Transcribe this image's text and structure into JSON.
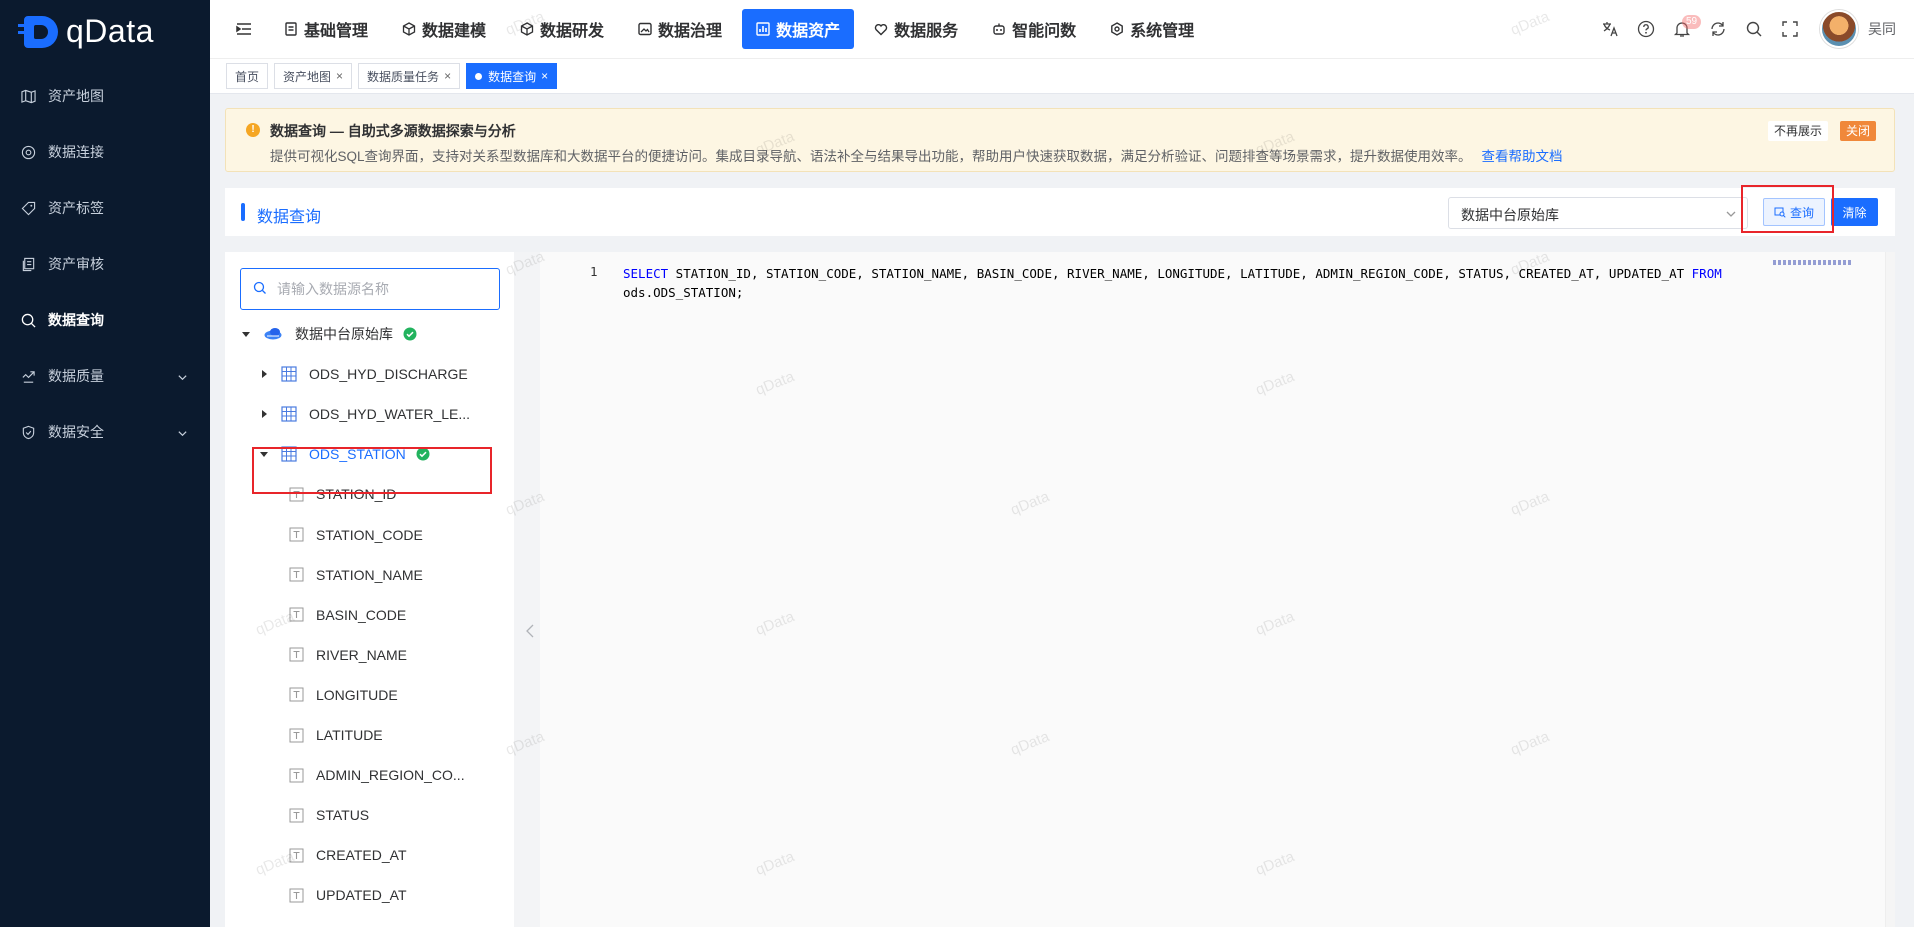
{
  "brand": {
    "name": "qData"
  },
  "sidebar": {
    "items": [
      {
        "label": "资产地图",
        "icon": "map-icon",
        "active": false,
        "expandable": false
      },
      {
        "label": "数据连接",
        "icon": "connection-icon",
        "active": false,
        "expandable": false
      },
      {
        "label": "资产标签",
        "icon": "tag-icon",
        "active": false,
        "expandable": false
      },
      {
        "label": "资产审核",
        "icon": "audit-icon",
        "active": false,
        "expandable": false
      },
      {
        "label": "数据查询",
        "icon": "query-icon",
        "active": true,
        "expandable": false
      },
      {
        "label": "数据质量",
        "icon": "quality-icon",
        "active": false,
        "expandable": true
      },
      {
        "label": "数据安全",
        "icon": "shield-icon",
        "active": false,
        "expandable": true
      }
    ]
  },
  "topnav": {
    "items": [
      {
        "label": "基础管理",
        "icon": "doc-icon",
        "active": false
      },
      {
        "label": "数据建模",
        "icon": "cube-icon",
        "active": false
      },
      {
        "label": "数据研发",
        "icon": "cube-icon",
        "active": false
      },
      {
        "label": "数据治理",
        "icon": "image-icon",
        "active": false
      },
      {
        "label": "数据资产",
        "icon": "chart-icon",
        "active": true
      },
      {
        "label": "数据服务",
        "icon": "heart-icon",
        "active": false
      },
      {
        "label": "智能问数",
        "icon": "robot-icon",
        "active": false
      },
      {
        "label": "系统管理",
        "icon": "gear-icon",
        "active": false
      }
    ],
    "notification_count": "59",
    "user_name": "吴同"
  },
  "tabs": [
    {
      "label": "首页",
      "closable": false,
      "active": false
    },
    {
      "label": "资产地图",
      "closable": true,
      "active": false
    },
    {
      "label": "数据质量任务",
      "closable": true,
      "active": false
    },
    {
      "label": "数据查询",
      "closable": true,
      "active": true
    }
  ],
  "notice": {
    "title": "数据查询 — 自助式多源数据探索与分析",
    "description": "提供可视化SQL查询界面，支持对关系型数据库和大数据平台的便捷访问。集成目录导航、语法补全与结果导出功能，帮助用户快速获取数据，满足分析验证、问题排查等场景需求，提升数据使用效率。",
    "link": "查看帮助文档",
    "hide_label": "不再展示",
    "close_label": "关闭"
  },
  "query_header": {
    "title": "数据查询",
    "datasource": "数据中台原始库",
    "query_button": "查询",
    "clear_button": "清除"
  },
  "tree": {
    "search_placeholder": "请输入数据源名称",
    "nodes": [
      {
        "label": "数据中台原始库",
        "level": 0,
        "type": "db",
        "expanded": true,
        "check": true
      },
      {
        "label": "ODS_HYD_DISCHARGE",
        "level": 1,
        "type": "table",
        "expanded": false,
        "check": false
      },
      {
        "label": "ODS_HYD_WATER_LE...",
        "level": 1,
        "type": "table",
        "expanded": false,
        "check": false
      },
      {
        "label": "ODS_STATION",
        "level": 1,
        "type": "table",
        "expanded": true,
        "check": true,
        "selected": true
      },
      {
        "label": "STATION_ID",
        "level": 2,
        "type": "column"
      },
      {
        "label": "STATION_CODE",
        "level": 2,
        "type": "column"
      },
      {
        "label": "STATION_NAME",
        "level": 2,
        "type": "column"
      },
      {
        "label": "BASIN_CODE",
        "level": 2,
        "type": "column"
      },
      {
        "label": "RIVER_NAME",
        "level": 2,
        "type": "column"
      },
      {
        "label": "LONGITUDE",
        "level": 2,
        "type": "column"
      },
      {
        "label": "LATITUDE",
        "level": 2,
        "type": "column"
      },
      {
        "label": "ADMIN_REGION_CO...",
        "level": 2,
        "type": "column"
      },
      {
        "label": "STATUS",
        "level": 2,
        "type": "column"
      },
      {
        "label": "CREATED_AT",
        "level": 2,
        "type": "column"
      },
      {
        "label": "UPDATED_AT",
        "level": 2,
        "type": "column"
      }
    ]
  },
  "editor": {
    "line_number": "1",
    "kw_select": "SELECT",
    "columns": " STATION_ID, STATION_CODE, STATION_NAME, BASIN_CODE, RIVER_NAME, LONGITUDE, LATITUDE, ADMIN_REGION_CODE, STATUS, CREATED_AT, UPDATED_AT ",
    "kw_from": "FROM",
    "table": "ods.ODS_STATION;"
  },
  "watermark": "qData",
  "colors": {
    "primary": "#1a6dff",
    "sidebar_bg": "#0b1a2e",
    "highlight": "#e8252a",
    "notice_bg": "#fdf6e3",
    "close_btn": "#f0883a"
  }
}
